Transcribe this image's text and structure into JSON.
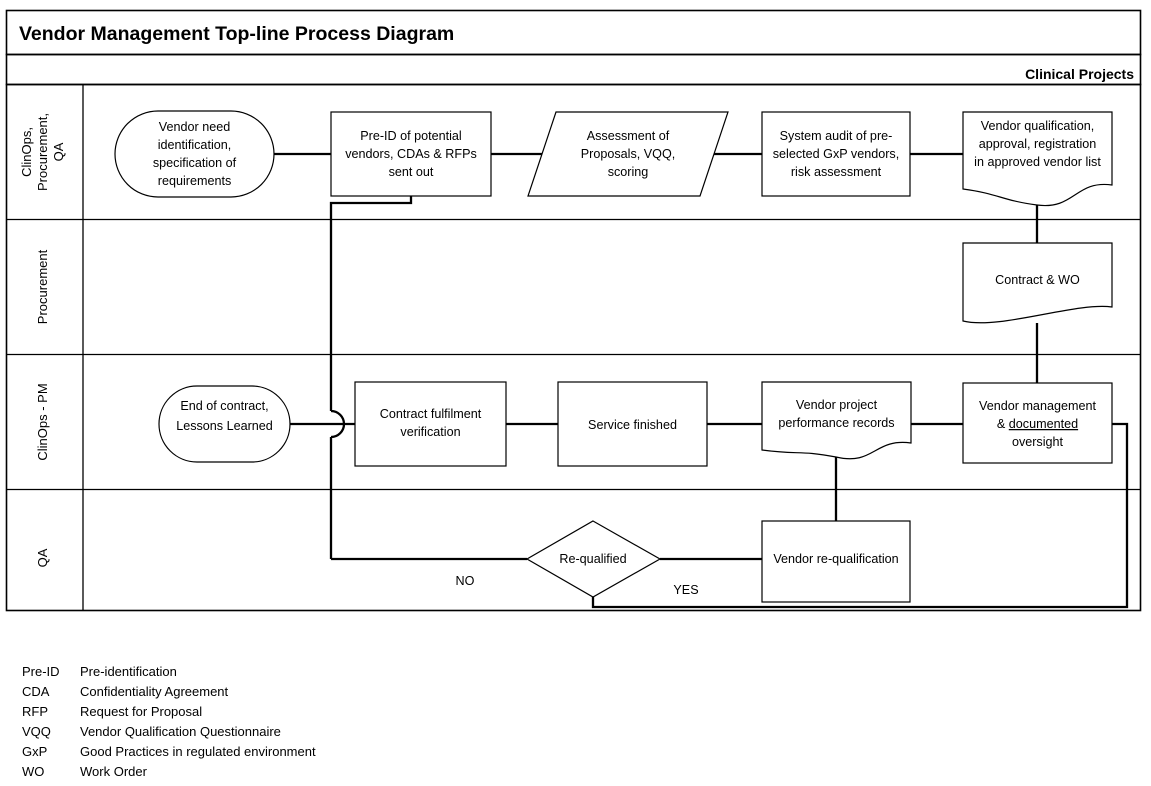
{
  "title": "Vendor Management Top-line Process Diagram",
  "pool": {
    "label": "Clinical Projects"
  },
  "lanes": [
    {
      "id": "lane-clinops-procurement-qa",
      "label": "ClinOps, Procurement, QA"
    },
    {
      "id": "lane-procurement",
      "label": "Procurement"
    },
    {
      "id": "lane-clinops-pm",
      "label": "ClinOps - PM"
    },
    {
      "id": "lane-qa",
      "label": "QA"
    }
  ],
  "nodes": [
    {
      "id": "vendor-need-identification",
      "shape": "rounded-terminator",
      "lane": "ClinOps, Procurement, QA",
      "lines": [
        "Vendor need",
        "identification,",
        "specification of",
        "requirements"
      ]
    },
    {
      "id": "pre-id-potential-vendors",
      "shape": "process",
      "lane": "ClinOps, Procurement, QA",
      "lines": [
        "Pre-ID of potential",
        "vendors, CDAs & RFPs",
        "sent out"
      ]
    },
    {
      "id": "assessment-of-proposals",
      "shape": "parallelogram",
      "lane": "ClinOps, Procurement, QA",
      "lines": [
        "Assessment of",
        "Proposals, VQQ,",
        "scoring"
      ]
    },
    {
      "id": "system-audit-gxp-vendors",
      "shape": "process",
      "lane": "ClinOps, Procurement, QA",
      "lines": [
        "System audit of pre-",
        "selected GxP vendors,",
        "risk assessment"
      ]
    },
    {
      "id": "vendor-qualification-approval",
      "shape": "document",
      "lane": "ClinOps, Procurement, QA",
      "lines": [
        "Vendor qualification,",
        "approval, registration",
        "in approved vendor list"
      ]
    },
    {
      "id": "contract-and-wo",
      "shape": "document",
      "lane": "Procurement",
      "lines": [
        "Contract & WO"
      ]
    },
    {
      "id": "end-of-contract",
      "shape": "rounded-terminator",
      "lane": "ClinOps - PM",
      "lines": [
        "End of contract,",
        "Lessons Learned"
      ]
    },
    {
      "id": "contract-fulfilment-verification",
      "shape": "process",
      "lane": "ClinOps - PM",
      "lines": [
        "Contract fulfilment",
        "verification"
      ]
    },
    {
      "id": "service-finished",
      "shape": "process",
      "lane": "ClinOps - PM",
      "lines": [
        "Service finished"
      ]
    },
    {
      "id": "vendor-project-performance-records",
      "shape": "document",
      "lane": "ClinOps - PM",
      "lines": [
        "Vendor project",
        "performance records"
      ]
    },
    {
      "id": "vendor-management-oversight",
      "shape": "process",
      "lane": "ClinOps - PM",
      "lines": [
        "Vendor management",
        "& documented",
        "oversight"
      ],
      "underlined_word": "documented"
    },
    {
      "id": "re-qualified-decision",
      "shape": "diamond",
      "lane": "QA",
      "lines": [
        "Re-qualified"
      ]
    },
    {
      "id": "vendor-re-qualification",
      "shape": "process",
      "lane": "QA",
      "lines": [
        "Vendor re-qualification"
      ]
    }
  ],
  "edge_labels": [
    {
      "id": "edge-label-no",
      "text": "NO"
    },
    {
      "id": "edge-label-yes",
      "text": "YES"
    }
  ],
  "legend": [
    {
      "abbr": "Pre-ID",
      "meaning": "Pre-identification"
    },
    {
      "abbr": "CDA",
      "meaning": "Confidentiality Agreement"
    },
    {
      "abbr": "RFP",
      "meaning": "Request for Proposal"
    },
    {
      "abbr": "VQQ",
      "meaning": "Vendor Qualification Questionnaire"
    },
    {
      "abbr": "GxP",
      "meaning": "Good Practices in regulated environment"
    },
    {
      "abbr": "WO",
      "meaning": "Work Order"
    }
  ],
  "colors": {
    "stroke": "#000000",
    "fill": "#ffffff",
    "background": "#ffffff"
  }
}
